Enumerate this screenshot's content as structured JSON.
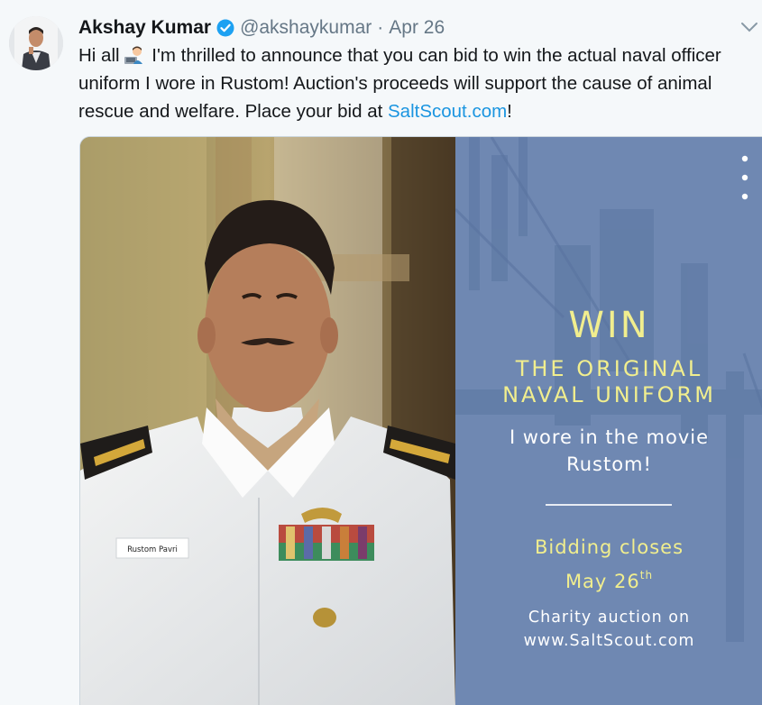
{
  "tweet": {
    "author_name": "Akshay Kumar",
    "handle": "@akshaykumar",
    "separator": "·",
    "date": "Apr 26",
    "text_part1": "Hi all",
    "text_part2": " I'm thrilled to announce that you can bid to win the actual naval officer uniform I wore in Rustom! Auction's proceeds will support the cause of animal rescue and welfare. Place your bid at ",
    "link_text": "SaltScout.com",
    "text_part3": "!"
  },
  "media": {
    "name_tag": "Rustom Pavri",
    "headline_win": "WIN",
    "headline_line1": "THE ORIGINAL",
    "headline_line2": "NAVAL UNIFORM",
    "subline1": "I wore in the movie",
    "subline2": "Rustom!",
    "bidding_line1": "Bidding closes",
    "bidding_line2_main": "May 26",
    "bidding_line2_sup": "th",
    "charity_line1": "Charity auction on",
    "charity_line2": "www.SaltScout.com"
  },
  "colors": {
    "link": "#1b95e0",
    "verified": "#1da1f2",
    "panel_bg": "#6f88b2",
    "panel_yellow": "#f1ee8e"
  },
  "icons": {
    "verified": "verified-badge-icon",
    "caret": "chevron-down-icon",
    "emoji": "man-technologist-emoji-icon",
    "more": "more-vertical-icon"
  }
}
